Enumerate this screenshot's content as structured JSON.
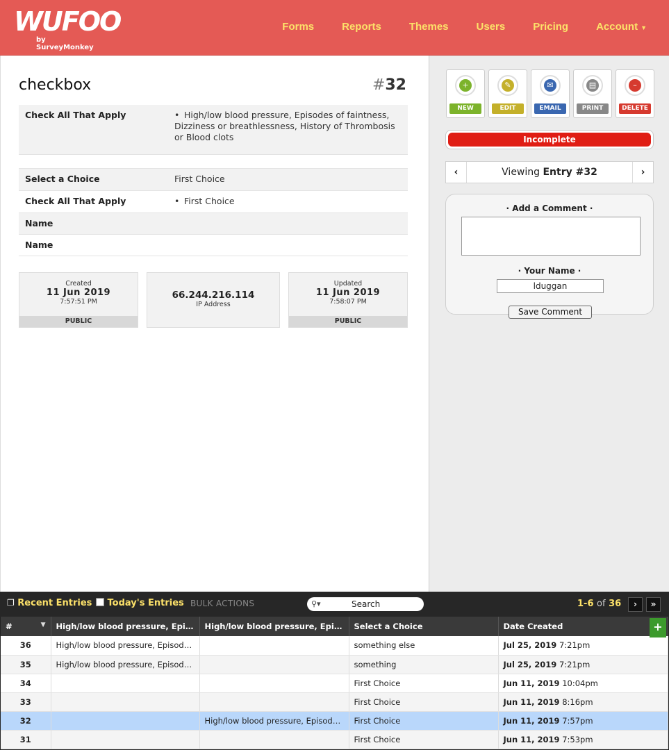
{
  "header": {
    "logo_text": "WUFOO",
    "logo_sub": "by SurveyMonkey",
    "nav": [
      "Forms",
      "Reports",
      "Themes",
      "Users",
      "Pricing",
      "Account"
    ],
    "bg_color": "#e45a55",
    "link_color": "#fce169"
  },
  "entry": {
    "title": "checkbox",
    "hash": "#",
    "number": "32",
    "fields": [
      {
        "label": "Check All That Apply",
        "value": "High/low blood pressure, Episodes of faintness, Dizziness or breathlessness, History of Thrombosis or Blood clots"
      },
      {
        "label": "Select a Choice",
        "value": "First Choice"
      },
      {
        "label": "Check All That Apply",
        "value": "First Choice"
      },
      {
        "label": "Name",
        "value": ""
      },
      {
        "label": "Name",
        "value": ""
      }
    ],
    "created": {
      "label": "Created",
      "date": "11 Jun 2019",
      "time": "7:57:51 PM",
      "visibility": "PUBLIC"
    },
    "ip": {
      "value": "66.244.216.114",
      "label": "IP Address"
    },
    "updated": {
      "label": "Updated",
      "date": "11 Jun 2019",
      "time": "7:58:07 PM",
      "visibility": "PUBLIC"
    }
  },
  "actions": [
    {
      "label": "NEW",
      "color": "#7cb32b",
      "icon": "new-document-icon"
    },
    {
      "label": "EDIT",
      "color": "#c4b02a",
      "icon": "edit-pencil-icon"
    },
    {
      "label": "EMAIL",
      "color": "#3a67b0",
      "icon": "envelope-icon"
    },
    {
      "label": "PRINT",
      "color": "#888888",
      "icon": "printer-icon"
    },
    {
      "label": "DELETE",
      "color": "#d63a2f",
      "icon": "delete-document-icon"
    }
  ],
  "status": {
    "label": "Incomplete",
    "color": "#e01d14"
  },
  "pager": {
    "prefix": "Viewing",
    "bold": "Entry #32"
  },
  "comment": {
    "add_label": "Add a Comment",
    "name_label": "Your Name",
    "name_value": "lduggan",
    "save_label": "Save Comment"
  },
  "entries_bar": {
    "recent": "Recent Entries",
    "today": "Today's Entries",
    "bulk": "BULK ACTIONS",
    "search_placeholder": "Search",
    "range": "1-6",
    "of": "of",
    "total": "36",
    "next": "›",
    "last": "»"
  },
  "table": {
    "headers": [
      "#",
      "High/low blood pressure, Episo...",
      "High/low blood pressure, Episo...",
      "Select a Choice",
      "Date Created"
    ],
    "add_col": "+",
    "rows": [
      {
        "num": "36",
        "c1": "High/low blood pressure, Episode...",
        "c2": "",
        "c3": "something else",
        "date": "Jul 25, 2019",
        "time": "7:21pm"
      },
      {
        "num": "35",
        "c1": "High/low blood pressure, Episode...",
        "c2": "",
        "c3": "something",
        "date": "Jul 25, 2019",
        "time": "7:21pm"
      },
      {
        "num": "34",
        "c1": "",
        "c2": "",
        "c3": "First Choice",
        "date": "Jun 11, 2019",
        "time": "10:04pm"
      },
      {
        "num": "33",
        "c1": "",
        "c2": "",
        "c3": "First Choice",
        "date": "Jun 11, 2019",
        "time": "8:16pm"
      },
      {
        "num": "32",
        "c1": "",
        "c2": "High/low blood pressure, Episodes...",
        "c3": "First Choice",
        "date": "Jun 11, 2019",
        "time": "7:57pm"
      },
      {
        "num": "31",
        "c1": "",
        "c2": "",
        "c3": "First Choice",
        "date": "Jun 11, 2019",
        "time": "7:53pm"
      }
    ]
  }
}
